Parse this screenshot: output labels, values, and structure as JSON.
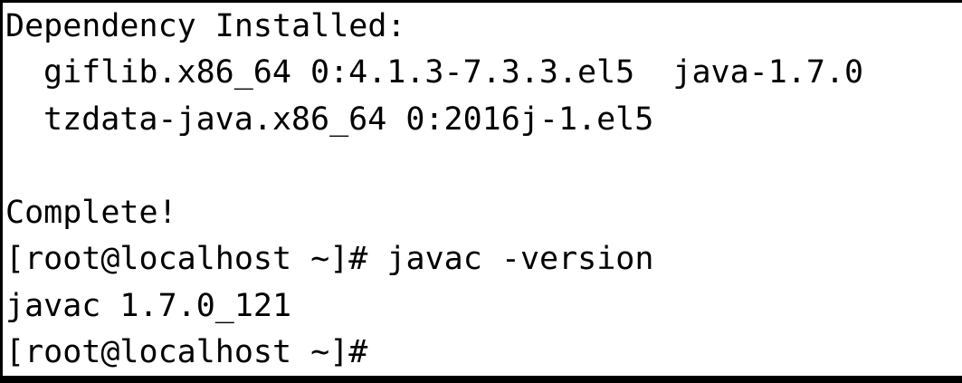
{
  "terminal": {
    "lines": [
      "Dependency Installed:",
      "giflib.x86_64 0:4.1.3-7.3.3.el5  java-1.7.0",
      "tzdata-java.x86_64 0:2016j-1.el5",
      "",
      "Complete!",
      "[root@localhost ~]# javac -version",
      "javac 1.7.0_121",
      "[root@localhost ~]#"
    ]
  },
  "colors": {
    "background": "#ffffff",
    "text": "#000000",
    "frame": "#000000"
  }
}
